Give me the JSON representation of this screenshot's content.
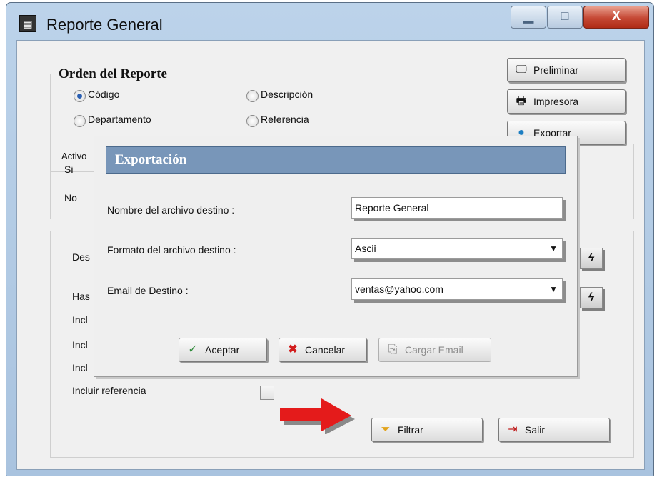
{
  "window": {
    "title": "Reporte General",
    "controls": {
      "minimize": "▁",
      "maximize": "□",
      "close": "X"
    }
  },
  "orden": {
    "heading": "Orden del Reporte",
    "options": [
      {
        "label": "Código",
        "checked": true
      },
      {
        "label": "Descripción",
        "checked": false
      },
      {
        "label": "Departamento",
        "checked": false
      },
      {
        "label": "Referencia",
        "checked": false
      }
    ]
  },
  "side_buttons": {
    "preliminar": "Preliminar",
    "impresora": "Impresora",
    "exportar": "Exportar"
  },
  "activo": {
    "label": "Activo",
    "si": "Si",
    "no": "No"
  },
  "filters": {
    "desde_partial": "Des",
    "hasta_partial": "Has",
    "incl1": "Incl",
    "incl2": "Incl",
    "incl3": "Incl",
    "incluir_referencia": "Incluir referencia"
  },
  "bottom_buttons": {
    "filtrar": "Filtrar",
    "salir": "Salir"
  },
  "dialog": {
    "title": "Exportación",
    "nombre_label": "Nombre del  archivo destino :",
    "nombre_value": "Reporte General",
    "formato_label": "Formato del  archivo destino :",
    "formato_value": "Ascii",
    "email_label": "Email de Destino :",
    "email_value": "ventas@yahoo.com",
    "aceptar": "Aceptar",
    "cancelar": "Cancelar",
    "cargar_email": "Cargar Email"
  },
  "colors": {
    "dialog_title_bg": "#7896b9",
    "arrow": "#e41b1b",
    "close_button": "#c54834"
  }
}
